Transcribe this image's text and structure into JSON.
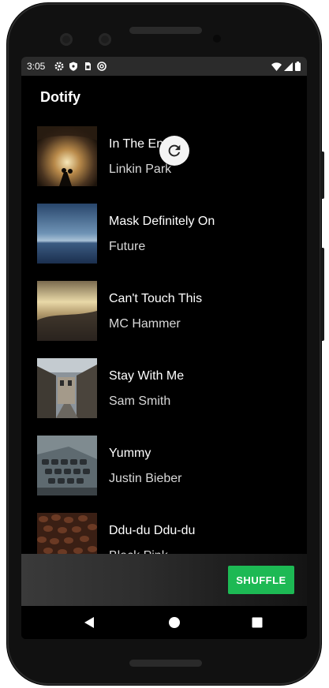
{
  "status_bar": {
    "time": "3:05",
    "left_icons": [
      "settings-icon",
      "shield-icon",
      "sim-icon",
      "at-icon"
    ],
    "right_icons": [
      "wifi-icon",
      "signal-icon",
      "battery-icon"
    ]
  },
  "app": {
    "title": "Dotify"
  },
  "songs": [
    {
      "title": "In The End",
      "artist": "Linkin Park"
    },
    {
      "title": "Mask Definitely On",
      "artist": "Future"
    },
    {
      "title": "Can't Touch This",
      "artist": "MC Hammer"
    },
    {
      "title": "Stay With Me",
      "artist": "Sam Smith"
    },
    {
      "title": "Yummy",
      "artist": "Justin Bieber"
    },
    {
      "title": "Ddu-du Ddu-du",
      "artist": "Black Pink"
    }
  ],
  "shuffle": {
    "label": "SHUFFLE",
    "color": "#1db954"
  },
  "navigation": {
    "icons": [
      "back-icon",
      "home-icon",
      "recents-icon"
    ]
  }
}
